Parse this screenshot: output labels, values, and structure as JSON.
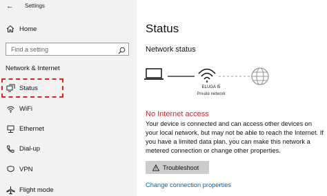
{
  "window": {
    "title": "Settings"
  },
  "sidebar": {
    "home_label": "Home",
    "search_placeholder": "Find a setting",
    "section_header": "Network & Internet",
    "items": [
      {
        "label": "Status",
        "icon": "status-icon"
      },
      {
        "label": "WiFi",
        "icon": "wifi-icon"
      },
      {
        "label": "Ethernet",
        "icon": "ethernet-icon"
      },
      {
        "label": "Dial-up",
        "icon": "dial-up-icon"
      },
      {
        "label": "VPN",
        "icon": "vpn-icon"
      },
      {
        "label": "Flight mode",
        "icon": "airplane-icon"
      }
    ]
  },
  "main": {
    "title": "Status",
    "network_status_heading": "Network status",
    "network_name": "ELUGA I5",
    "network_type": "Private network",
    "alert_title": "No Internet access",
    "description": "Your device is connected and can access other devices on your local network, but may not be able to reach the Internet. If you have a limited data plan, you can make this network a metered connection or change other properties.",
    "troubleshoot_label": "Troubleshoot",
    "change_link": "Change connection properties"
  },
  "colors": {
    "alert": "#e02020",
    "link": "#0063b1",
    "highlight": "#e02020"
  }
}
